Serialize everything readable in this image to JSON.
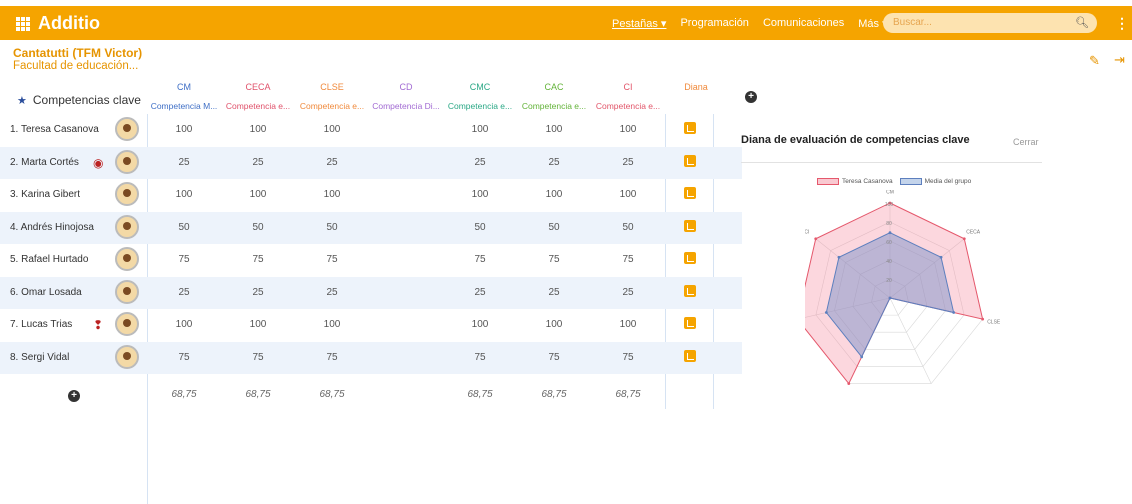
{
  "app": {
    "title": "Additio"
  },
  "nav": {
    "tabs": "Pestañas ▾",
    "schedule": "Programación",
    "communications": "Comunicaciones",
    "more": "Más ▾"
  },
  "search": {
    "placeholder": "Buscar..."
  },
  "course": {
    "title": "Cantatutti (TFM Victor)",
    "subtitle": "Facultad de educación..."
  },
  "grid": {
    "header_label": "Competencias clave",
    "columns": [
      {
        "code": "CM",
        "full": "Competencia M...",
        "color": "#3f6fc6"
      },
      {
        "code": "CECA",
        "full": "Competencia e...",
        "color": "#e0526b"
      },
      {
        "code": "CLSE",
        "full": "Competencia e...",
        "color": "#f08a3c"
      },
      {
        "code": "CD",
        "full": "Competencia Di...",
        "color": "#a26bd3"
      },
      {
        "code": "CMC",
        "full": "Competencia e...",
        "color": "#2ba886"
      },
      {
        "code": "CAC",
        "full": "Competencia e...",
        "color": "#63b339"
      },
      {
        "code": "CI",
        "full": "Competencia e...",
        "color": "#e2566a"
      }
    ],
    "diana_header": "Diana",
    "students": [
      {
        "name": "1. Teresa Casanova",
        "values": [
          "100",
          "100",
          "100",
          "",
          "100",
          "100",
          "100"
        ]
      },
      {
        "name": "2. Marta Cortés",
        "values": [
          "25",
          "25",
          "25",
          "",
          "25",
          "25",
          "25"
        ]
      },
      {
        "name": "3. Karina Gibert",
        "values": [
          "100",
          "100",
          "100",
          "",
          "100",
          "100",
          "100"
        ]
      },
      {
        "name": "4. Andrés Hinojosa",
        "values": [
          "50",
          "50",
          "50",
          "",
          "50",
          "50",
          "50"
        ]
      },
      {
        "name": "5. Rafael Hurtado",
        "values": [
          "75",
          "75",
          "75",
          "",
          "75",
          "75",
          "75"
        ]
      },
      {
        "name": "6. Omar Losada",
        "values": [
          "25",
          "25",
          "25",
          "",
          "25",
          "25",
          "25"
        ]
      },
      {
        "name": "7. Lucas Trias",
        "values": [
          "100",
          "100",
          "100",
          "",
          "100",
          "100",
          "100"
        ]
      },
      {
        "name": "8. Sergi Vidal",
        "values": [
          "75",
          "75",
          "75",
          "",
          "75",
          "75",
          "75"
        ]
      }
    ],
    "averages": [
      "68,75",
      "68,75",
      "68,75",
      "",
      "68,75",
      "68,75",
      "68,75"
    ]
  },
  "panel": {
    "title": "Diana de evaluación de competencias clave",
    "close_label": "Cerrar",
    "legend": [
      "Teresa Casanova",
      "Media del grupo"
    ]
  },
  "chart_data": {
    "type": "radar",
    "categories": [
      "CM",
      "CECA",
      "CLSE",
      "CD",
      "CMC",
      "CAC",
      "CI"
    ],
    "scale_ticks": [
      "20",
      "40",
      "60",
      "80",
      "100"
    ],
    "ylim": [
      0,
      100
    ],
    "series": [
      {
        "name": "Teresa Casanova",
        "values": [
          100,
          100,
          100,
          0,
          100,
          100,
          100
        ],
        "color": "#e5586c"
      },
      {
        "name": "Media del grupo",
        "values": [
          68.75,
          68.75,
          68.75,
          0,
          68.75,
          68.75,
          68.75
        ],
        "color": "#5d7fbe"
      }
    ]
  }
}
